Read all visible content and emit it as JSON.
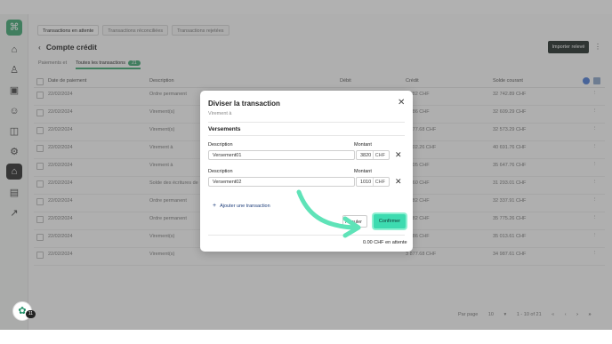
{
  "tabs_top": [
    "Transactions en attente",
    "Transactions réconciliées",
    "Transactions rejetées"
  ],
  "page": {
    "back": "‹",
    "title": "Compte crédit",
    "import_button": "Importer relevé",
    "more": "⋮"
  },
  "subtabs": [
    {
      "label": "Paiements et",
      "active": false
    },
    {
      "label": "Toutes les transactions",
      "active": true,
      "count": "21"
    }
  ],
  "table": {
    "headers": [
      "Date de paiement",
      "Description",
      "Débit",
      "Crédit",
      "Solde courant"
    ],
    "rows": [
      [
        "22/02/2024",
        "Ordre permanent",
        "",
        "3 982 CHF",
        "32 742.89 CHF"
      ],
      [
        "22/02/2024",
        "Virement(s)",
        "",
        "2 386 CHF",
        "32 609.29 CHF"
      ],
      [
        "22/02/2024",
        "Virement(s)",
        "",
        "3 877.68 CHF",
        "32 573.29 CHF"
      ],
      [
        "22/02/2024",
        "Virement à",
        "",
        "3 002.26 CHF",
        "40 691.76 CHF"
      ],
      [
        "22/02/2024",
        "Virement à",
        "",
        "1 205 CHF",
        "35 647.76 CHF"
      ],
      [
        "22/02/2024",
        "Solde des écritures de",
        "",
        "2 260 CHF",
        "31 293.01 CHF"
      ],
      [
        "22/02/2024",
        "Ordre permanent",
        "",
        "3 982 CHF",
        "32 337.91 CHF"
      ],
      [
        "22/02/2024",
        "Ordre permanent",
        "",
        "3 982 CHF",
        "35 775.26 CHF"
      ],
      [
        "22/02/2024",
        "Virement(s)",
        "",
        "2 386 CHF",
        "35 013.61 CHF"
      ],
      [
        "22/02/2024",
        "Virement(s)",
        "",
        "3 877.68 CHF",
        "34 987.61 CHF"
      ]
    ]
  },
  "pagination": {
    "label": "Par page",
    "per_page": "10",
    "range": "1 - 10 of 21"
  },
  "modal": {
    "title": "Diviser la transaction",
    "subtitle": "Virement à",
    "section": "Versements",
    "desc_label": "Description",
    "amount_label": "Montant",
    "lines": [
      {
        "description": "Versement01",
        "amount": "3820",
        "currency": "CHF"
      },
      {
        "description": "Versement02",
        "amount": "1010",
        "currency": "CHF"
      }
    ],
    "add_line": "Ajouter une transaction",
    "cancel": "Annuler",
    "confirm": "Confirmer",
    "pending": "0.00 CHF en attente"
  },
  "help_badge": "11",
  "colors": {
    "accent": "#3ea873",
    "confirm": "#3ddbb0",
    "arrow": "#5fe3b8"
  },
  "icons": [
    "home-icon",
    "user-icon",
    "chart-icon",
    "person-icon",
    "bag-icon",
    "settings-icon",
    "bank-icon",
    "document-icon",
    "stats-icon"
  ]
}
